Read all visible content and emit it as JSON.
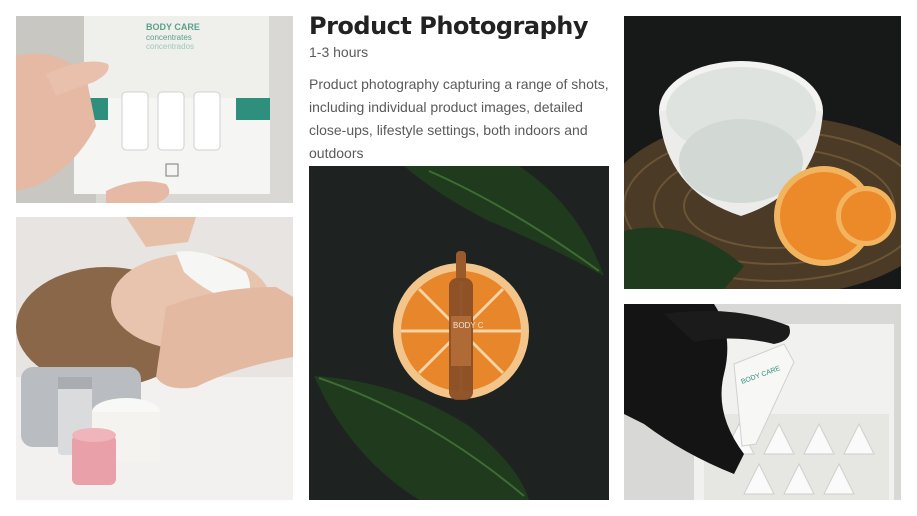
{
  "title": "Product Photography",
  "duration": "1-3 hours",
  "description": "Product photography capturing a range of shots, including individual product images, detailed close-ups, lifestyle settings, both indoors and outdoors",
  "photos": {
    "box": {
      "brand": "BODY CARE",
      "line1": "concentrates",
      "line2": "concentrados"
    },
    "ampoule": {
      "label": "BODY C"
    },
    "tube": {
      "label": "BODY CARE"
    }
  },
  "colors": {
    "teal": "#2f8f7d",
    "orange": "#e8862c",
    "leaf": "#1f3a1c",
    "dark_bg": "#1e2220"
  }
}
